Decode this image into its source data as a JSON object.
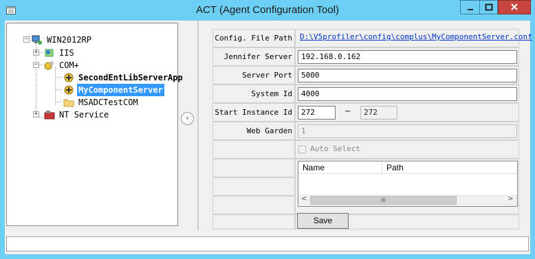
{
  "window": {
    "title": "ACT (Agent Configuration Tool)",
    "accent": "#6ecff5",
    "close_color": "#c7443f"
  },
  "tree": {
    "root": "WIN2012RP",
    "iis": "IIS",
    "complus": "COM+",
    "complus_children": [
      "SecondEntLibServerApp",
      "MyComponentServer",
      "MSADCTestCOM"
    ],
    "nt_service": "NT Service",
    "selected": "MyComponentServer"
  },
  "form": {
    "config_path_label": "Config. File Path",
    "config_path_value": "D:\\V5profiler\\config\\complus\\MyComponentServer.conf",
    "jennifer_server_label": "Jennifer Server",
    "jennifer_server_value": "192.168.0.162",
    "server_port_label": "Server Port",
    "server_port_value": "5000",
    "system_id_label": "System Id",
    "system_id_value": "4000",
    "start_instance_label": "Start Instance Id",
    "start_instance_from": "272",
    "start_instance_sep": "~",
    "start_instance_to": "272",
    "web_garden_label": "Web Garden",
    "web_garden_value": "1",
    "auto_select_label": "Auto Select",
    "list_columns": [
      "Name",
      "Path"
    ],
    "scroll_grip": "III",
    "save_label": "Save"
  }
}
